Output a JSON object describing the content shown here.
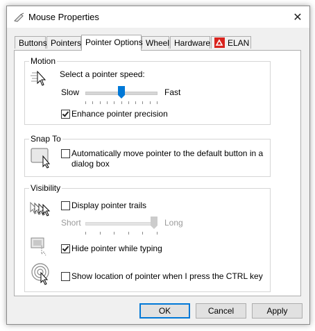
{
  "window": {
    "title": "Mouse Properties",
    "close_label": "✕"
  },
  "tabs": [
    {
      "label": "Buttons",
      "active": false
    },
    {
      "label": "Pointers",
      "active": false
    },
    {
      "label": "Pointer Options",
      "active": true
    },
    {
      "label": "Wheel",
      "active": false
    },
    {
      "label": "Hardware",
      "active": false
    },
    {
      "label": "ELAN",
      "active": false
    }
  ],
  "motion": {
    "title": "Motion",
    "speed_label": "Select a pointer speed:",
    "slow_label": "Slow",
    "fast_label": "Fast",
    "speed_level": 0.5,
    "precision_label": "Enhance pointer precision",
    "precision_checked": true
  },
  "snap_to": {
    "title": "Snap To",
    "option_label": "Automatically move pointer to the default button in a",
    "option_label_2": "dialog box",
    "checked": false
  },
  "visibility": {
    "title": "Visibility",
    "trails_label": "Display pointer trails",
    "trails_checked": false,
    "short_label": "Short",
    "long_label": "Long",
    "trails_level": 1.0,
    "hide_label": "Hide pointer while typing",
    "hide_checked": true,
    "ctrl_label": "Show location of pointer when I press the CTRL key",
    "ctrl_checked": false
  },
  "buttons": {
    "ok": "OK",
    "cancel": "Cancel",
    "apply": "Apply"
  },
  "colors": {
    "accent": "#0078d7",
    "elan_red": "#d9231e"
  }
}
